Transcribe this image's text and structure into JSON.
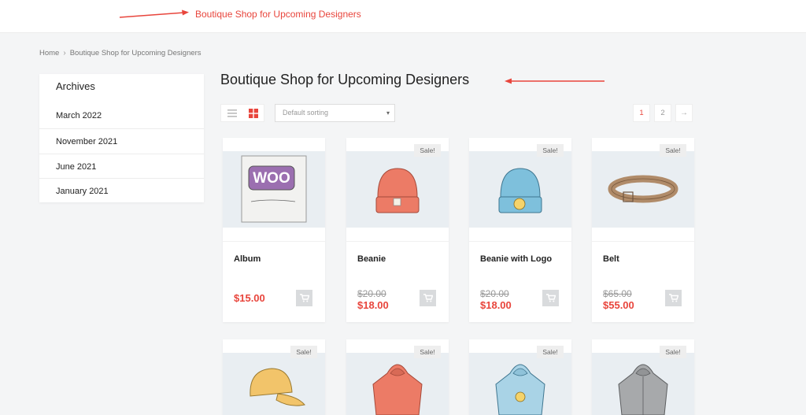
{
  "header": {
    "site_title": "Boutique Shop for Upcoming Designers"
  },
  "breadcrumb": {
    "home": "Home",
    "current": "Boutique Shop for Upcoming Designers"
  },
  "sidebar": {
    "title": "Archives",
    "items": [
      {
        "label": "March 2022"
      },
      {
        "label": "November 2021"
      },
      {
        "label": "June 2021"
      },
      {
        "label": "January 2021"
      }
    ]
  },
  "main": {
    "title": "Boutique Shop for Upcoming Designers",
    "sort": {
      "selected": "Default sorting"
    },
    "pagination": {
      "pages": [
        "1",
        "2"
      ],
      "active": "1",
      "next_icon": "arrow-right-icon"
    }
  },
  "products": [
    {
      "name": "Album",
      "price": "$15.00",
      "sale": false,
      "image": "album-image"
    },
    {
      "name": "Beanie",
      "old_price": "$20.00",
      "price": "$18.00",
      "sale": true,
      "sale_label": "Sale!",
      "image": "beanie-image"
    },
    {
      "name": "Beanie with Logo",
      "old_price": "$20.00",
      "price": "$18.00",
      "sale": true,
      "sale_label": "Sale!",
      "image": "beanie-logo-image"
    },
    {
      "name": "Belt",
      "old_price": "$65.00",
      "price": "$55.00",
      "sale": true,
      "sale_label": "Sale!",
      "image": "belt-image"
    },
    {
      "sale": true,
      "sale_label": "Sale!",
      "image": "cap-image"
    },
    {
      "sale": true,
      "sale_label": "Sale!",
      "image": "hoodie-red-image"
    },
    {
      "sale": true,
      "sale_label": "Sale!",
      "image": "hoodie-blue-image"
    },
    {
      "sale": true,
      "sale_label": "Sale!",
      "image": "hoodie-grey-image"
    }
  ],
  "colors": {
    "accent": "#e8453c",
    "image_bg": "#e9eef2"
  }
}
